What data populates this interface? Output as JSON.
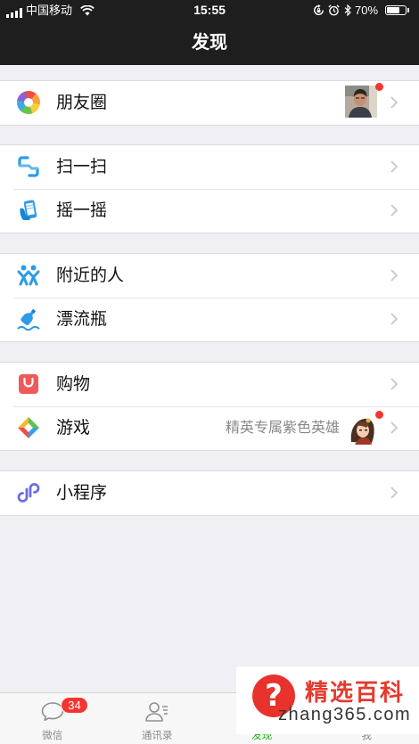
{
  "status_bar": {
    "carrier": "中国移动",
    "time": "15:55",
    "battery": "70%",
    "battery_level": 0.7
  },
  "header": {
    "title": "发现"
  },
  "menu": {
    "moments": {
      "label": "朋友圈",
      "icon": "moments-icon",
      "has_new": true
    },
    "scan": {
      "label": "扫一扫",
      "icon": "scan-icon"
    },
    "shake": {
      "label": "摇一摇",
      "icon": "shake-icon"
    },
    "nearby": {
      "label": "附近的人",
      "icon": "people-nearby-icon"
    },
    "bottle": {
      "label": "漂流瓶",
      "icon": "drift-bottle-icon"
    },
    "shopping": {
      "label": "购物",
      "icon": "shopping-bag-icon"
    },
    "games": {
      "label": "游戏",
      "icon": "games-icon",
      "detail": "精英专属紫色英雄",
      "has_new": true
    },
    "mini_programs": {
      "label": "小程序",
      "icon": "mini-program-icon"
    }
  },
  "tab_bar": {
    "items": [
      {
        "label": "微信",
        "icon": "chat-icon",
        "badge": "34",
        "active": false
      },
      {
        "label": "通讯录",
        "icon": "contacts-icon",
        "active": false
      },
      {
        "label": "发现",
        "icon": "discover-icon",
        "active": true
      },
      {
        "label": "我",
        "icon": "me-icon",
        "active": false
      }
    ]
  },
  "watermark": {
    "logo_glyph": "?",
    "title": "精选百科",
    "domain": "zhang365.com"
  },
  "colors": {
    "header_bg": "#1e1e1e",
    "page_bg": "#efeff4",
    "accent_green": "#1aad19",
    "badge_red": "#f43530",
    "icon_blue": "#2d9be6",
    "watermark_red": "#e8322c"
  }
}
